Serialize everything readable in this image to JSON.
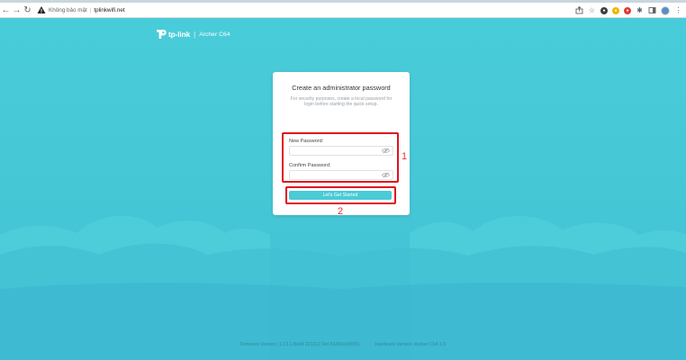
{
  "browser": {
    "security_text": "Không bảo mật",
    "url": "tplinkwifi.net",
    "ext_letters": [
      "",
      ""
    ]
  },
  "brand": {
    "name": "tp-link",
    "separator": "|",
    "model": "Archer C64"
  },
  "card": {
    "title": "Create an administrator password",
    "description": "For security purposes, create a local password for login before starting the quick setup.",
    "new_password_label": "New Password:",
    "new_password_value": "",
    "confirm_password_label": "Confirm Password:",
    "confirm_password_value": "",
    "button_label": "Let's Get Started"
  },
  "annotations": {
    "box1_number": "1",
    "box2_number": "2",
    "color": "#e0121f"
  },
  "footer": {
    "firmware": "Firmware Version: 1.13.1 Build 221212 Rel.66256n(4555)",
    "hardware": "Hardware Version: Archer C64 1.0"
  },
  "colors": {
    "background": "#4bcbd8",
    "accent": "#4acbd6"
  }
}
